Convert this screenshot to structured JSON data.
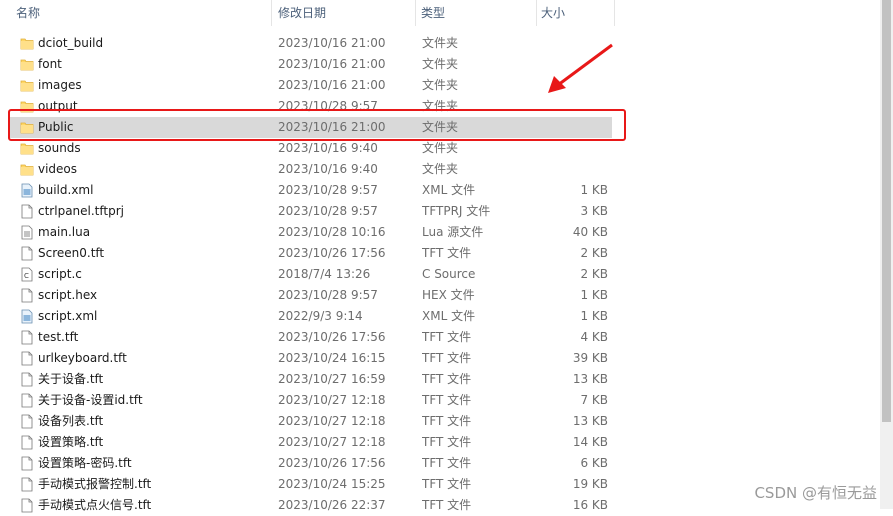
{
  "columns": {
    "name": "名称",
    "date": "修改日期",
    "type": "类型",
    "size": "大小"
  },
  "accent": {
    "selection": "#d9d9d9",
    "highlight_border": "#e81818",
    "folder": "#ffd766",
    "arrow": "#e81818"
  },
  "files": [
    {
      "name": "dciot_build",
      "date": "2023/10/16 21:00",
      "type": "文件夹",
      "size": "",
      "icon": "folder-icon"
    },
    {
      "name": "font",
      "date": "2023/10/16 21:00",
      "type": "文件夹",
      "size": "",
      "icon": "folder-icon"
    },
    {
      "name": "images",
      "date": "2023/10/16 21:00",
      "type": "文件夹",
      "size": "",
      "icon": "folder-icon"
    },
    {
      "name": "output",
      "date": "2023/10/28 9:57",
      "type": "文件夹",
      "size": "",
      "icon": "folder-icon"
    },
    {
      "name": "Public",
      "date": "2023/10/16 21:00",
      "type": "文件夹",
      "size": "",
      "icon": "folder-icon",
      "selected": true
    },
    {
      "name": "sounds",
      "date": "2023/10/16 9:40",
      "type": "文件夹",
      "size": "",
      "icon": "folder-icon"
    },
    {
      "name": "videos",
      "date": "2023/10/16 9:40",
      "type": "文件夹",
      "size": "",
      "icon": "folder-icon"
    },
    {
      "name": "build.xml",
      "date": "2023/10/28 9:57",
      "type": "XML 文件",
      "size": "1 KB",
      "icon": "xml-file-icon"
    },
    {
      "name": "ctrlpanel.tftprj",
      "date": "2023/10/28 9:57",
      "type": "TFTPRJ 文件",
      "size": "3 KB",
      "icon": "file-icon"
    },
    {
      "name": "main.lua",
      "date": "2023/10/28 10:16",
      "type": "Lua 源文件",
      "size": "40 KB",
      "icon": "text-file-icon"
    },
    {
      "name": "Screen0.tft",
      "date": "2023/10/26 17:56",
      "type": "TFT 文件",
      "size": "2 KB",
      "icon": "file-icon"
    },
    {
      "name": "script.c",
      "date": "2018/7/4 13:26",
      "type": "C Source",
      "size": "2 KB",
      "icon": "c-source-icon"
    },
    {
      "name": "script.hex",
      "date": "2023/10/28 9:57",
      "type": "HEX 文件",
      "size": "1 KB",
      "icon": "file-icon"
    },
    {
      "name": "script.xml",
      "date": "2022/9/3 9:14",
      "type": "XML 文件",
      "size": "1 KB",
      "icon": "xml-file-icon"
    },
    {
      "name": "test.tft",
      "date": "2023/10/26 17:56",
      "type": "TFT 文件",
      "size": "4 KB",
      "icon": "file-icon"
    },
    {
      "name": "urlkeyboard.tft",
      "date": "2023/10/24 16:15",
      "type": "TFT 文件",
      "size": "39 KB",
      "icon": "file-icon"
    },
    {
      "name": "关于设备.tft",
      "date": "2023/10/27 16:59",
      "type": "TFT 文件",
      "size": "13 KB",
      "icon": "file-icon"
    },
    {
      "name": "关于设备-设置id.tft",
      "date": "2023/10/27 12:18",
      "type": "TFT 文件",
      "size": "7 KB",
      "icon": "file-icon"
    },
    {
      "name": "设备列表.tft",
      "date": "2023/10/27 12:18",
      "type": "TFT 文件",
      "size": "13 KB",
      "icon": "file-icon"
    },
    {
      "name": "设置策略.tft",
      "date": "2023/10/27 12:18",
      "type": "TFT 文件",
      "size": "14 KB",
      "icon": "file-icon"
    },
    {
      "name": "设置策略-密码.tft",
      "date": "2023/10/26 17:56",
      "type": "TFT 文件",
      "size": "6 KB",
      "icon": "file-icon"
    },
    {
      "name": "手动模式报警控制.tft",
      "date": "2023/10/24 15:25",
      "type": "TFT 文件",
      "size": "19 KB",
      "icon": "file-icon"
    },
    {
      "name": "手动模式点火信号.tft",
      "date": "2023/10/26 22:37",
      "type": "TFT 文件",
      "size": "16 KB",
      "icon": "file-icon"
    }
  ],
  "watermark": "CSDN @有恒无益"
}
